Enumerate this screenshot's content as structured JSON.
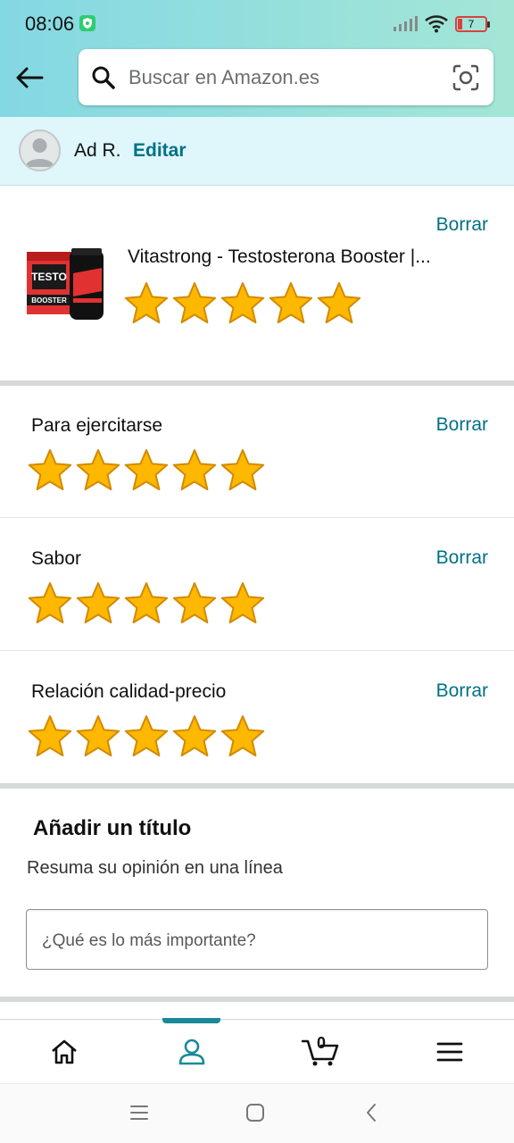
{
  "status_bar": {
    "time": "08:06",
    "battery": "7"
  },
  "header": {
    "search_placeholder": "Buscar en Amazon.es"
  },
  "user": {
    "name": "Ad R.",
    "edit_label": "Editar"
  },
  "product": {
    "title": "Vitastrong - Testosterona Booster |...",
    "delete_label": "Borrar",
    "rating": 5,
    "image_label_top": "TESTO",
    "image_label_bottom": "BOOSTER"
  },
  "aspects": [
    {
      "label": "Para ejercitarse",
      "delete_label": "Borrar",
      "rating": 5
    },
    {
      "label": "Sabor",
      "delete_label": "Borrar",
      "rating": 5
    },
    {
      "label": "Relación calidad-precio",
      "delete_label": "Borrar",
      "rating": 5
    }
  ],
  "title_section": {
    "heading": "Añadir un título",
    "subtitle": "Resuma su opinión en una línea",
    "input_placeholder": "¿Qué es lo más importante?"
  },
  "bottom_nav": {
    "items": [
      "home-icon",
      "account-icon",
      "cart-icon",
      "menu-icon"
    ],
    "active": "account-icon",
    "cart_count": "0"
  },
  "colors": {
    "link": "#007185",
    "star": "#ffb800",
    "star_outline": "#d38a00",
    "active_nav": "#1a8a99"
  }
}
